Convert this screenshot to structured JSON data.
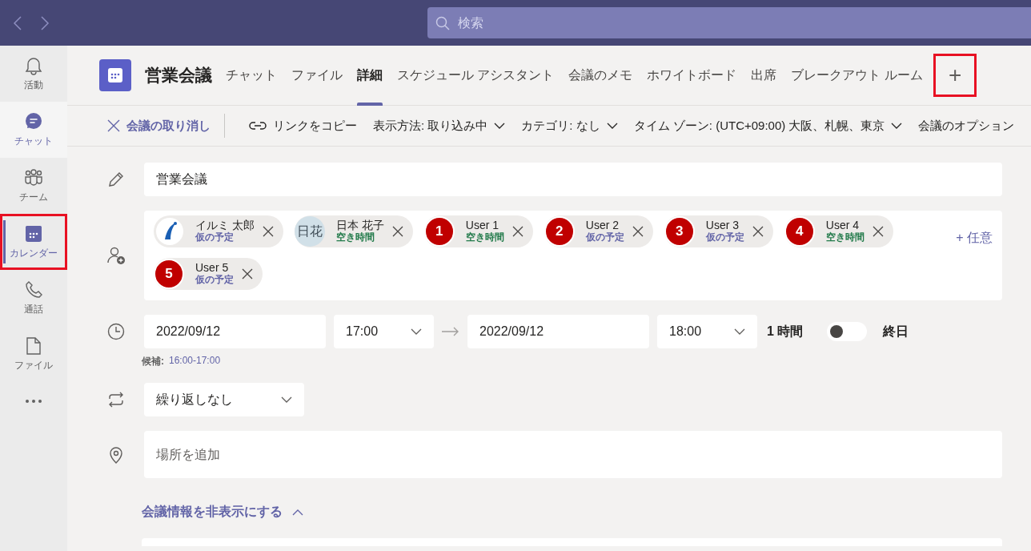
{
  "top_bar": {
    "search": {
      "placeholder": "検索"
    }
  },
  "rail": {
    "items": [
      {
        "label": "活動",
        "selected": false,
        "hovered": false,
        "highlighted": false
      },
      {
        "label": "チャット",
        "selected": false,
        "hovered": true,
        "highlighted": false
      },
      {
        "label": "チーム",
        "selected": false,
        "hovered": false,
        "highlighted": false
      },
      {
        "label": "カレンダー",
        "selected": true,
        "hovered": false,
        "highlighted": true
      },
      {
        "label": "通話",
        "selected": false,
        "hovered": false,
        "highlighted": false
      },
      {
        "label": "ファイル",
        "selected": false,
        "hovered": false,
        "highlighted": false
      }
    ]
  },
  "meeting": {
    "title": "営業会議",
    "tabs": [
      {
        "label": "チャット",
        "selected": false,
        "highlighted": false
      },
      {
        "label": "ファイル",
        "selected": false,
        "highlighted": false
      },
      {
        "label": "詳細",
        "selected": true,
        "highlighted": false
      },
      {
        "label": "スケジュール アシスタント",
        "selected": false,
        "highlighted": false
      },
      {
        "label": "会議のメモ",
        "selected": false,
        "highlighted": false
      },
      {
        "label": "ホワイトボード",
        "selected": false,
        "highlighted": false
      },
      {
        "label": "出席",
        "selected": false,
        "highlighted": false
      },
      {
        "label": "ブレークアウト ルーム",
        "selected": false,
        "highlighted": false
      },
      {
        "label": "+",
        "selected": false,
        "highlighted": true
      }
    ]
  },
  "toolbar": {
    "items": [
      {
        "kind": "cancel",
        "label": "会議の取り消し"
      },
      {
        "kind": "link",
        "label": "リンクをコピー"
      },
      {
        "kind": "dropdown",
        "label": "表示方法: 取り込み中"
      },
      {
        "kind": "dropdown",
        "label": "カテゴリ: なし"
      },
      {
        "kind": "dropdown",
        "label": "タイム ゾーン: (UTC+09:00) 大阪、札幌、東京"
      },
      {
        "kind": "plain",
        "label": "会議のオプション"
      }
    ]
  },
  "form": {
    "title_value": "営業会議",
    "attendees": [
      {
        "kind": "logo",
        "name": "イルミ 太郎",
        "status": "仮の予定",
        "color": "#6264a7"
      },
      {
        "kind": "initials",
        "avatar_text": "日花",
        "name": "日本 花子",
        "status": "空き時間",
        "color": "#237b4b"
      },
      {
        "kind": "number",
        "avatar_text": "1",
        "name": "User 1",
        "status": "空き時間",
        "color": "#237b4b"
      },
      {
        "kind": "number",
        "avatar_text": "2",
        "name": "User 2",
        "status": "仮の予定",
        "color": "#6264a7"
      },
      {
        "kind": "number",
        "avatar_text": "3",
        "name": "User 3",
        "status": "仮の予定",
        "color": "#6264a7"
      },
      {
        "kind": "number",
        "avatar_text": "4",
        "name": "User 4",
        "status": "空き時間",
        "color": "#237b4b"
      },
      {
        "kind": "number",
        "avatar_text": "5",
        "name": "User 5",
        "status": "仮の予定",
        "color": "#6264a7"
      }
    ],
    "optional_link": "+ 任意",
    "start_date": "2022/09/12",
    "start_time": "17:00",
    "end_date": "2022/09/12",
    "end_time": "18:00",
    "duration": "1 時間",
    "all_day": {
      "label": "終日",
      "on": false
    },
    "suggestion_label": "候補:",
    "suggestion_value": "16:00-17:00",
    "recurrence": "繰り返しなし",
    "location_placeholder": "場所を追加",
    "details_toggle": "会議情報を非表示にする",
    "details_expanded": true
  }
}
